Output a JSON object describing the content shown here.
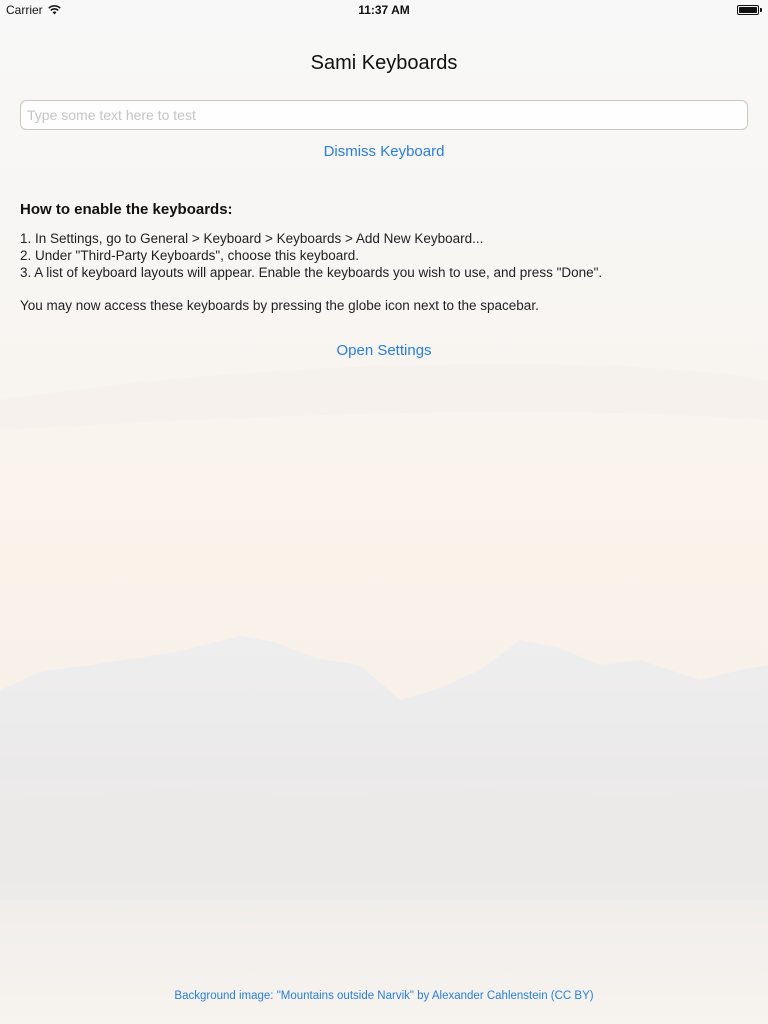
{
  "status_bar": {
    "carrier": "Carrier",
    "time": "11:37 AM",
    "wifi_icon": "wifi-icon",
    "battery_icon": "battery-icon"
  },
  "title": "Sami Keyboards",
  "test_input": {
    "placeholder": "Type some text here to test",
    "value": ""
  },
  "dismiss_label": "Dismiss Keyboard",
  "instructions": {
    "heading": "How to enable the keyboards:",
    "steps": [
      "1. In Settings, go to General > Keyboard > Keyboards > Add New Keyboard...",
      "2. Under \"Third-Party Keyboards\", choose this keyboard.",
      "3. A list of keyboard layouts will appear. Enable the keyboards you wish to use, and press \"Done\"."
    ],
    "note": "You may now access these keyboards by pressing the globe icon next to the spacebar."
  },
  "open_settings_label": "Open Settings",
  "attribution": "Background image: \"Mountains outside Narvik\" by Alexander Cahlenstein (CC BY)",
  "colors": {
    "link": "#2a7ed6",
    "text": "#222222",
    "input_border": "#c8c8c8"
  }
}
